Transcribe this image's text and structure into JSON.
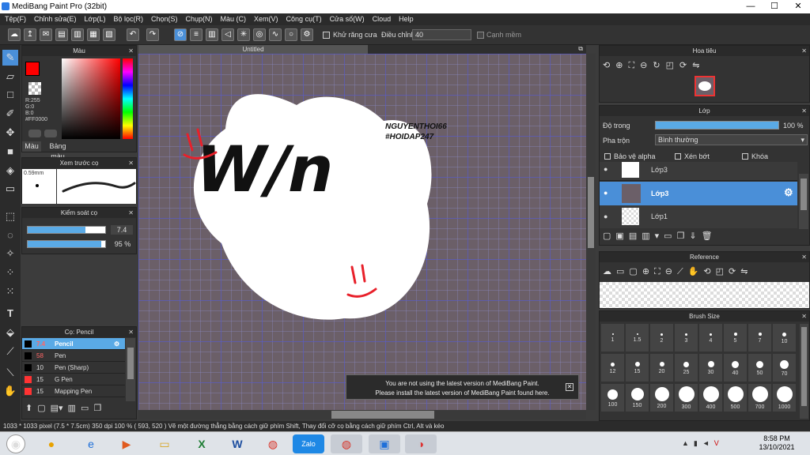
{
  "window": {
    "title": "MediBang Paint Pro (32bit)",
    "min": "—",
    "max": "☐",
    "close": "✕"
  },
  "menu": [
    "Tệp(F)",
    "Chỉnh sửa(E)",
    "Lớp(L)",
    "Bộ lọc(R)",
    "Chọn(S)",
    "Chụp(N)",
    "Màu (C)",
    "Xem(V)",
    "Công cụ(T)",
    "Cửa số(W)",
    "Cloud",
    "Help"
  ],
  "toolbar": {
    "antialias": "Khử răng cưa",
    "adjust_label": "Điều chỉnh",
    "adjust_value": "40",
    "smooth": "Cạnh mềm"
  },
  "color_panel": {
    "title": "Màu",
    "r": "R:255",
    "g": "G:0",
    "b": "B:0",
    "hex": "#FF0000",
    "tab1": "Màu",
    "tab2": "Bảng màu",
    "primary": "#ff0000",
    "secondary": "#0000ff"
  },
  "brush_preview": {
    "title": "Xem trước cọ",
    "size": "0.59mm"
  },
  "brush_control": {
    "title": "Kiểm soát cọ",
    "size": "7.4",
    "opacity": "95 %",
    "size_fill": 0.74,
    "opacity_fill": 0.95
  },
  "brush_list": {
    "title": "Cọ: Pencil",
    "items": [
      {
        "size": "7.4",
        "name": "Pencil",
        "color": "#000000",
        "active": true
      },
      {
        "size": "58",
        "name": "Pen",
        "color": "#000000",
        "active": false
      },
      {
        "size": "10",
        "name": "Pen (Sharp)",
        "color": "#000000",
        "active": false
      },
      {
        "size": "15",
        "name": "G Pen",
        "color": "#ff0000",
        "active": false
      },
      {
        "size": "15",
        "name": "Mapping Pen",
        "color": "#ff0000",
        "active": false
      }
    ]
  },
  "canvas": {
    "tab": "Untitled",
    "text1": "W/n",
    "watermark1": "NGUYENTHOI66",
    "watermark2": "#HOIDAP247"
  },
  "navigator": {
    "title": "Hoa tiêu"
  },
  "layers": {
    "title": "Lớp",
    "opacity_label": "Độ trong",
    "opacity_value": "100 %",
    "blend_label": "Pha trộn",
    "blend_value": "Bình thường",
    "protect_alpha": "Bảo vệ alpha",
    "clip": "Xén bớt",
    "lock": "Khóa",
    "items": [
      "Lớp3",
      "Lớp3",
      "Lớp1"
    ]
  },
  "reference": {
    "title": "Reference"
  },
  "brush_size": {
    "title": "Brush Size",
    "sizes": [
      "1",
      "1.5",
      "2",
      "3",
      "4",
      "5",
      "7",
      "10",
      "12",
      "15",
      "20",
      "25",
      "30",
      "40",
      "50",
      "70",
      "100",
      "150",
      "200",
      "300",
      "400",
      "500",
      "700",
      "1000"
    ]
  },
  "notification": {
    "line1": "You are not using the latest version of MediBang Paint.",
    "line2": "Please install the latest version of MediBang Paint found here."
  },
  "status": {
    "text": "1033 * 1033 pixel   (7.5 * 7.5cm)   350 dpi   100 %   ( 593, 520 )  Vẽ một đường thẳng bằng cách giữ phím Shift, Thay đổi cỡ cọ bằng cách giữ phím Ctrl, Alt và kéo"
  },
  "taskbar": {
    "time": "8:58 PM",
    "date": "13/10/2021"
  }
}
